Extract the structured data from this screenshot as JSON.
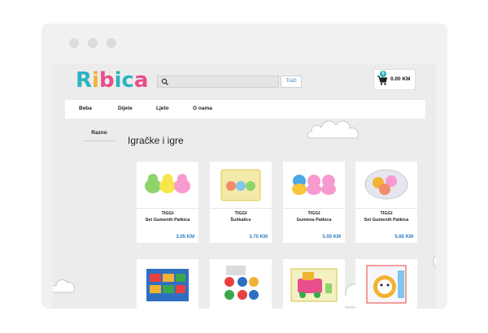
{
  "logo": {
    "letters": [
      "R",
      "i",
      "b",
      "i",
      "c",
      "a"
    ],
    "colors": [
      "#2bb3c0",
      "#f2b233",
      "#e94d8b",
      "#2bb3c0",
      "#2bb3c0",
      "#e94d8b"
    ]
  },
  "search": {
    "placeholder": "",
    "button_label": "Traži",
    "icon": "search-icon"
  },
  "cart": {
    "count": "0",
    "total": "0.00 KM",
    "icon": "cart-icon"
  },
  "nav": {
    "items": [
      "Beba",
      "Dijete",
      "Ljeto",
      "O nama"
    ]
  },
  "sidebar": {
    "item": "Razno"
  },
  "page": {
    "title": "Igračke i igre"
  },
  "products": [
    {
      "brand": "TIGGI",
      "name": "Set Gumenih Patkica",
      "price": "3.05 KM"
    },
    {
      "brand": "TIGGI",
      "name": "Šuškalice",
      "price": "3.70 KM"
    },
    {
      "brand": "TIGGI",
      "name": "Gumena Patkica",
      "price": "5.05 KM"
    },
    {
      "brand": "TIGGI",
      "name": "Set Gumenih Patkica",
      "price": "5.60 KM"
    },
    {
      "brand": "",
      "name": "",
      "price": ""
    },
    {
      "brand": "",
      "name": "",
      "price": ""
    },
    {
      "brand": "",
      "name": "",
      "price": ""
    },
    {
      "brand": "",
      "name": "",
      "price": ""
    }
  ],
  "colors": {
    "accent": "#2d7fc2",
    "brand_teal": "#2bb3c0",
    "brand_pink": "#e94d8b",
    "brand_yellow": "#f2b233"
  }
}
